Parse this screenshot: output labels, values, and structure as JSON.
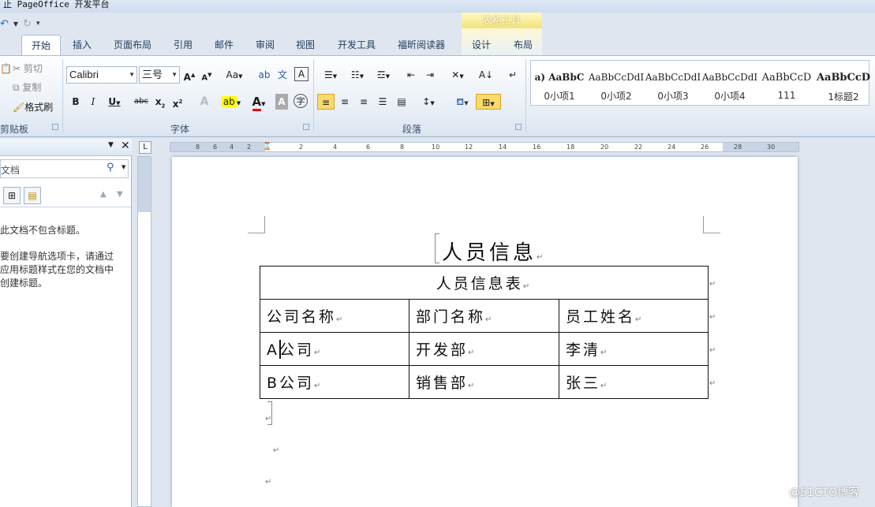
{
  "window": {
    "title": "止 PageOffice 开发平台"
  },
  "context_tab_header": "表格工具",
  "tabs": [
    "开始",
    "插入",
    "页面布局",
    "引用",
    "邮件",
    "审阅",
    "视图",
    "开发工具",
    "福昕阅读器",
    "设计",
    "布局"
  ],
  "clipboard": {
    "cut": "剪切",
    "copy": "复制",
    "format_painter": "格式刷",
    "group": "剪贴板"
  },
  "font": {
    "name": "Calibri",
    "size": "三号",
    "group": "字体",
    "change_case": "Aa"
  },
  "paragraph": {
    "group": "段落"
  },
  "styles": [
    {
      "preview": "a) AaBbC",
      "name": "0小项1"
    },
    {
      "preview": "AaBbCcDdI",
      "name": "0小项2"
    },
    {
      "preview": "AaBbCcDdI",
      "name": "0小项3"
    },
    {
      "preview": "AaBbCcDdI",
      "name": "0小项4"
    },
    {
      "preview": "AaBbCcD",
      "name": "111"
    },
    {
      "preview": "AaBbCcD",
      "name": "1标题2"
    }
  ],
  "nav": {
    "search_placeholder": "文档",
    "message1": "此文档不包含标题。",
    "message2_l1": "要创建导航选项卡，请通过",
    "message2_l2": "应用标题样式在您的文档中",
    "message2_l3": "创建标题。"
  },
  "ruler": {
    "marks": [
      "8",
      "6",
      "4",
      "2",
      "2",
      "4",
      "6",
      "8",
      "10",
      "12",
      "14",
      "16",
      "18",
      "20",
      "22",
      "24",
      "26",
      "28",
      "30"
    ]
  },
  "document": {
    "title": "人员信息",
    "table": {
      "header": "人员信息表",
      "columns": [
        "公司名称",
        "部门名称",
        "员工姓名"
      ],
      "rows": [
        [
          "A公司",
          "开发部",
          "李清"
        ],
        [
          "B公司",
          "销售部",
          "张三"
        ]
      ]
    },
    "para_mark": "↵"
  },
  "watermark": "@51CTO博客"
}
